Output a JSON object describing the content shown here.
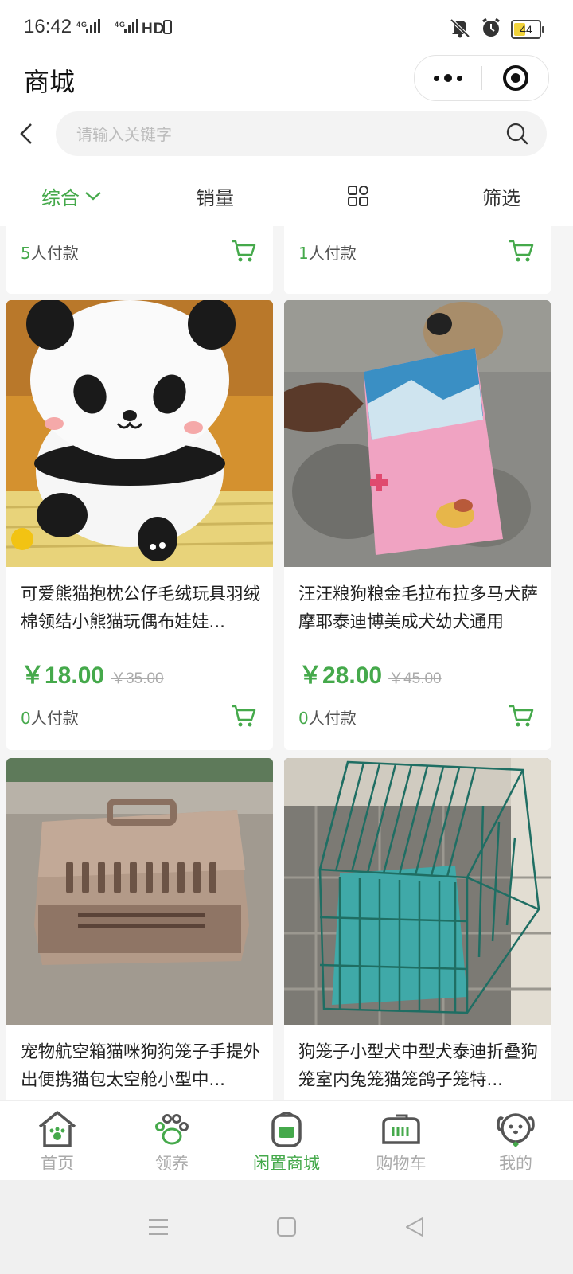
{
  "status_bar": {
    "time": "16:42",
    "network": "4G 4G HD",
    "battery": "44"
  },
  "header": {
    "title": "商城"
  },
  "search": {
    "placeholder": "请输入关键字"
  },
  "sort_tabs": [
    {
      "label": "综合",
      "active": true
    },
    {
      "label": "销量",
      "active": false
    },
    {
      "label": "grid-view-icon",
      "active": false
    },
    {
      "label": "筛选",
      "active": false
    }
  ],
  "top_cards": [
    {
      "paid_count": "5",
      "paid_suffix": "人付款"
    },
    {
      "paid_count": "1",
      "paid_suffix": "人付款"
    }
  ],
  "products": [
    {
      "name": "可爱熊猫抱枕公仔毛绒玩具羽绒棉领结小熊猫玩偶布娃娃...",
      "price": "￥18.00",
      "old_price": "￥35.00",
      "paid_count": "0",
      "paid_suffix": "人付款"
    },
    {
      "name": "汪汪粮狗粮金毛拉布拉多马犬萨摩耶泰迪博美成犬幼犬通用",
      "price": "￥28.00",
      "old_price": "￥45.00",
      "paid_count": "0",
      "paid_suffix": "人付款"
    },
    {
      "name": "宠物航空箱猫咪狗狗笼子手提外出便携猫包太空舱小型中...",
      "price": "",
      "old_price": "",
      "paid_count": "",
      "paid_suffix": ""
    },
    {
      "name": "狗笼子小型犬中型犬泰迪折叠狗笼室内兔笼猫笼鸽子笼特...",
      "price": "",
      "old_price": "",
      "paid_count": "",
      "paid_suffix": ""
    }
  ],
  "bottom_tabs": [
    {
      "label": "首页",
      "icon": "home-icon"
    },
    {
      "label": "领养",
      "icon": "paw-icon"
    },
    {
      "label": "闲置商城",
      "icon": "backpack-icon",
      "active": true
    },
    {
      "label": "购物车",
      "icon": "pet-carrier-icon"
    },
    {
      "label": "我的",
      "icon": "dog-face-icon"
    }
  ],
  "colors": {
    "accent": "#45a94b",
    "muted": "#aaaaaa"
  }
}
